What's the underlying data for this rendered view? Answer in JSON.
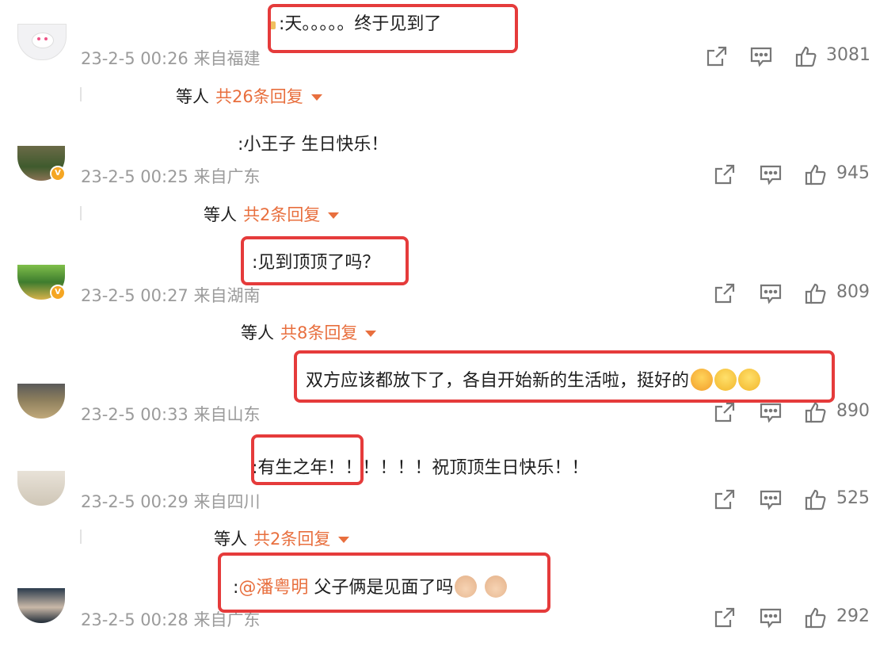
{
  "comments": [
    {
      "text": ":天。。。。。终于见到了",
      "date": "23-2-5 00:26",
      "location": "来自福建",
      "likes": "3081",
      "reply": {
        "who": "等人",
        "count": "共26条回复"
      }
    },
    {
      "text": ":小王子 生日快乐！",
      "date": "23-2-5 00:25",
      "location": "来自广东",
      "likes": "945",
      "reply": {
        "who": "等人",
        "count": "共2条回复"
      }
    },
    {
      "text": ":见到顶顶了吗？",
      "date": "23-2-5 00:27",
      "location": "来自湖南",
      "likes": "809",
      "reply": {
        "who": "等人",
        "count": "共8条回复"
      }
    },
    {
      "text": "双方应该都放下了，各自开始新的生活啦，挺好的",
      "date": "23-2-5 00:33",
      "location": "来自山东",
      "likes": "890",
      "emojis": [
        "tears-of-joy-emoji",
        "crying-emoji",
        "crying-emoji"
      ]
    },
    {
      "text": ":有生之年！！！！！！祝顶顶生日快乐！！",
      "date": "23-2-5 00:29",
      "location": "来自四川",
      "likes": "525",
      "reply": {
        "who": "等人",
        "count": "共2条回复"
      }
    },
    {
      "text_prefix": ":",
      "mention": "@潘粤明",
      "text_suffix": " 父子俩是见面了吗",
      "date": "23-2-5 00:28",
      "location": "来自广东",
      "likes": "292",
      "emojis": [
        "man-face-emoji",
        "boy-face-emoji"
      ]
    }
  ],
  "icons": {
    "share": "share-icon",
    "comment": "comment-icon",
    "like": "like-icon"
  },
  "colors": {
    "accent": "#e86f3e",
    "highlight_box": "#e53b3b",
    "meta": "#9b9b9b"
  }
}
